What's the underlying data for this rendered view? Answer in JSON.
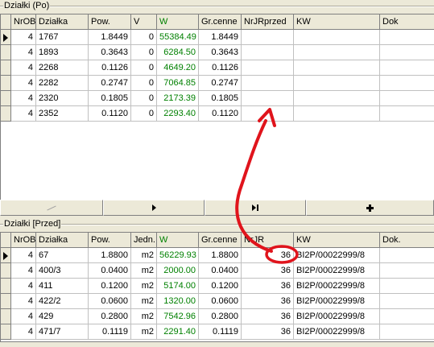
{
  "top_group": {
    "title": "Działki (Po)",
    "columns": [
      "NrOB",
      "Działka",
      "Pow.",
      "V",
      "W",
      "Gr.cenne",
      "NrJRprzed",
      "KW",
      "Dok"
    ],
    "rows": [
      [
        "4",
        "1767",
        "1.8449",
        "0",
        "55384.49",
        "1.8449",
        "",
        "",
        ""
      ],
      [
        "4",
        "1893",
        "0.3643",
        "0",
        "6284.50",
        "0.3643",
        "",
        "",
        ""
      ],
      [
        "4",
        "2268",
        "0.1126",
        "0",
        "4649.20",
        "0.1126",
        "",
        "",
        ""
      ],
      [
        "4",
        "2282",
        "0.2747",
        "0",
        "7064.85",
        "0.2747",
        "",
        "",
        ""
      ],
      [
        "4",
        "2320",
        "0.1805",
        "0",
        "2173.39",
        "0.1805",
        "",
        "",
        ""
      ],
      [
        "4",
        "2352",
        "0.1120",
        "0",
        "2293.40",
        "0.1120",
        "",
        "",
        ""
      ]
    ]
  },
  "nav": {
    "buttons": [
      "prior-disabled",
      "next",
      "last",
      "insert"
    ]
  },
  "bottom_group": {
    "title": "Działki [Przed]",
    "columns": [
      "NrOB",
      "Działka",
      "Pow.",
      "Jedn.",
      "W",
      "Gr.cenne",
      "NrJR",
      "KW",
      "Dok."
    ],
    "rows": [
      [
        "4",
        "67",
        "1.8800",
        "m2",
        "56229.93",
        "1.8800",
        "36",
        "BI2P/00022999/8",
        ""
      ],
      [
        "4",
        "400/3",
        "0.0400",
        "m2",
        "2000.00",
        "0.0400",
        "36",
        "BI2P/00022999/8",
        ""
      ],
      [
        "4",
        "411",
        "0.1200",
        "m2",
        "5174.00",
        "0.1200",
        "36",
        "BI2P/00022999/8",
        ""
      ],
      [
        "4",
        "422/2",
        "0.0600",
        "m2",
        "1320.00",
        "0.0600",
        "36",
        "BI2P/00022999/8",
        ""
      ],
      [
        "4",
        "429",
        "0.2800",
        "m2",
        "7542.96",
        "0.2800",
        "36",
        "BI2P/00022999/8",
        ""
      ],
      [
        "4",
        "471/7",
        "0.1119",
        "m2",
        "2291.40",
        "0.1119",
        "36",
        "BI2P/00022999/8",
        ""
      ]
    ]
  },
  "colors": {
    "w_column": "#008000",
    "annotation": "#e0141c"
  }
}
